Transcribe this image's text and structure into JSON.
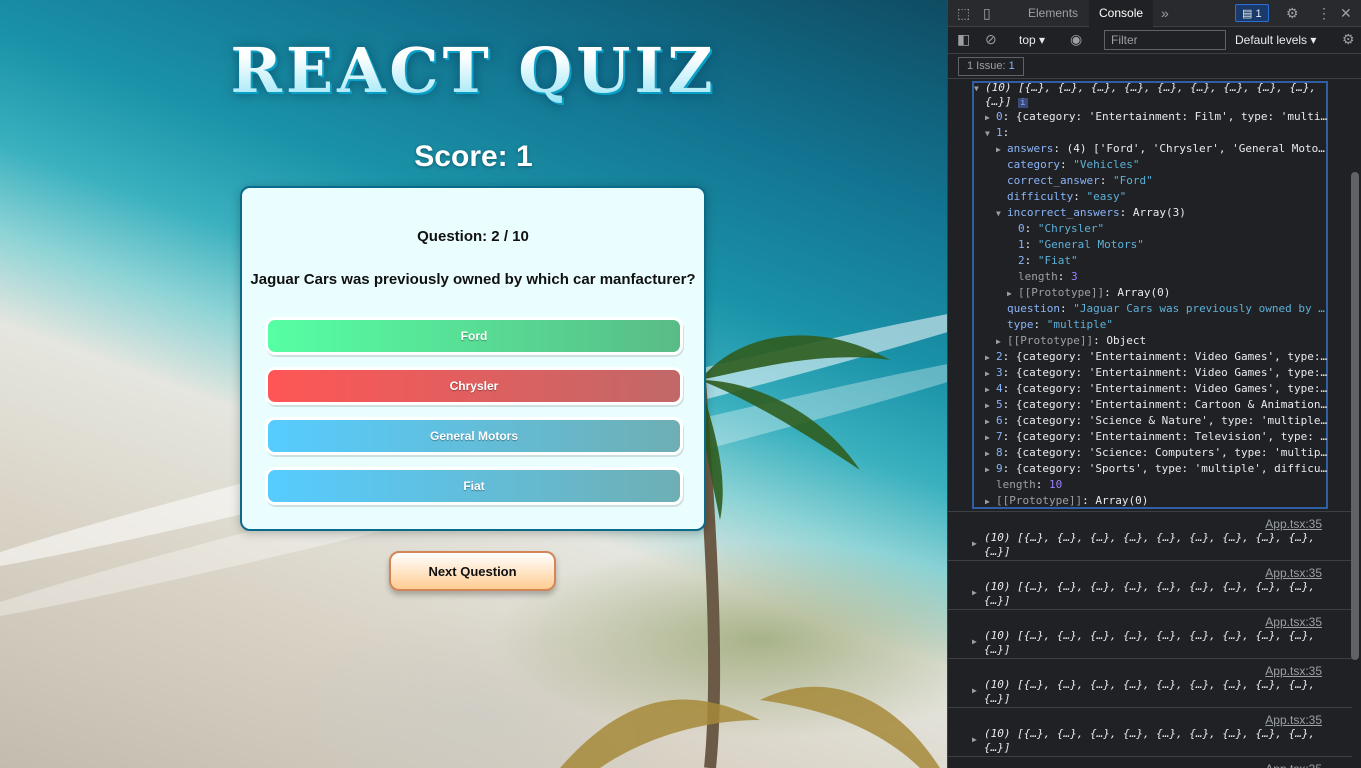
{
  "quiz": {
    "title": "REACT QUIZ",
    "score": "Score: 1",
    "question_number": "Question: 2 / 10",
    "question": "Jaguar Cars was previously owned by which car manfacturer?",
    "answers": [
      "Ford",
      "Chrysler",
      "General Motors",
      "Fiat"
    ],
    "next_button": "Next Question"
  },
  "devtools": {
    "tabs": [
      "Elements",
      "Console"
    ],
    "active_tab": "Console",
    "issues_badge": "1",
    "context": "top",
    "filter_placeholder": "Filter",
    "levels": "Default levels",
    "issues_button": {
      "label": "1 Issue:",
      "count": "1"
    },
    "expanded": {
      "header": "(10) [{…}, {…}, {…}, {…}, {…}, {…}, {…}, {…}, {…},",
      "header_cont": "{…}]",
      "item0": "{category: 'Entertainment: Film', type: 'multi…",
      "item1_answers_val": "(4) ['Ford', 'Chrysler', 'General Moto…",
      "item1_category": "\"Vehicles\"",
      "item1_correct_answer": "\"Ford\"",
      "item1_difficulty": "\"easy\"",
      "item1_incorrect_answers": "Array(3)",
      "incorrect": [
        "\"Chrysler\"",
        "\"General Motors\"",
        "\"Fiat\""
      ],
      "incorrect_length": "3",
      "proto_array0": "Array(0)",
      "item1_question": "\"Jaguar Cars was previously owned by …",
      "item1_type": "\"multiple\"",
      "proto_object": "Object",
      "rest": [
        "{category: 'Entertainment: Video Games', type:…",
        "{category: 'Entertainment: Video Games', type:…",
        "{category: 'Entertainment: Video Games', type:…",
        "{category: 'Entertainment: Cartoon & Animation…",
        "{category: 'Science & Nature', type: 'multiple…",
        "{category: 'Entertainment: Television', type: …",
        "{category: 'Science: Computers', type: 'multip…",
        "{category: 'Sports', type: 'multiple', difficu…"
      ],
      "length": "10",
      "proto_final": "Array(0)"
    },
    "log_source": "App.tsx:35",
    "log_line1": "(10) [{…}, {…}, {…}, {…}, {…}, {…}, {…}, {…}, {…},",
    "log_line2": "{…}]"
  }
}
